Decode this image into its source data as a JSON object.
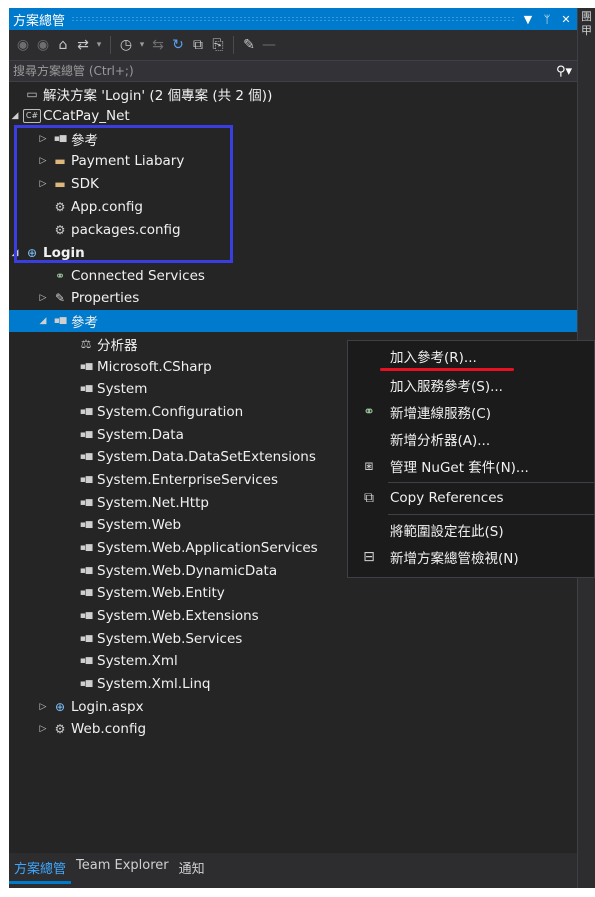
{
  "panel": {
    "title": "方案總管",
    "pin_glyph": "▾ ⫯",
    "close_glyph": "✕",
    "side_chars": [
      "團",
      "甲"
    ]
  },
  "toolbar": {
    "icons": [
      "back-icon",
      "forward-icon",
      "home-icon",
      "sync-icon",
      "history-icon",
      "pending-changes-icon",
      "refresh-icon",
      "collapse-all-icon",
      "show-all-files-icon",
      "properties-icon",
      "preview-icon"
    ]
  },
  "search": {
    "placeholder": "搜尋方案總管 (Ctrl+;)"
  },
  "tree": {
    "solution": "解決方案 'Login' (2 個專案 (共 2 個))",
    "project1": {
      "name": "CCatPay_Net",
      "children": [
        "參考",
        "Payment Liabary",
        "SDK",
        "App.config",
        "packages.config"
      ]
    },
    "project2": {
      "name": "Login",
      "connected_services": "Connected Services",
      "properties": "Properties",
      "references": "參考",
      "reference_items": [
        "分析器",
        "Microsoft.CSharp",
        "System",
        "System.Configuration",
        "System.Data",
        "System.Data.DataSetExtensions",
        "System.EnterpriseServices",
        "System.Net.Http",
        "System.Web",
        "System.Web.ApplicationServices",
        "System.Web.DynamicData",
        "System.Web.Entity",
        "System.Web.Extensions",
        "System.Web.Services",
        "System.Xml",
        "System.Xml.Linq"
      ],
      "files": [
        "Login.aspx",
        "Web.config"
      ]
    }
  },
  "context_menu": {
    "items": [
      "加入參考(R)...",
      "加入服務參考(S)...",
      "新增連線服務(C)",
      "新增分析器(A)...",
      "管理 NuGet 套件(N)...",
      "Copy References",
      "將範圍設定在此(S)",
      "新增方案總管檢視(N)"
    ]
  },
  "bottom_tabs": [
    "方案總管",
    "Team Explorer",
    "通知"
  ],
  "colors": {
    "accent": "#007acc",
    "background": "#252526",
    "highlight_box": "#3a3ee0",
    "underline": "#e81123",
    "folder": "#dcb67a"
  }
}
